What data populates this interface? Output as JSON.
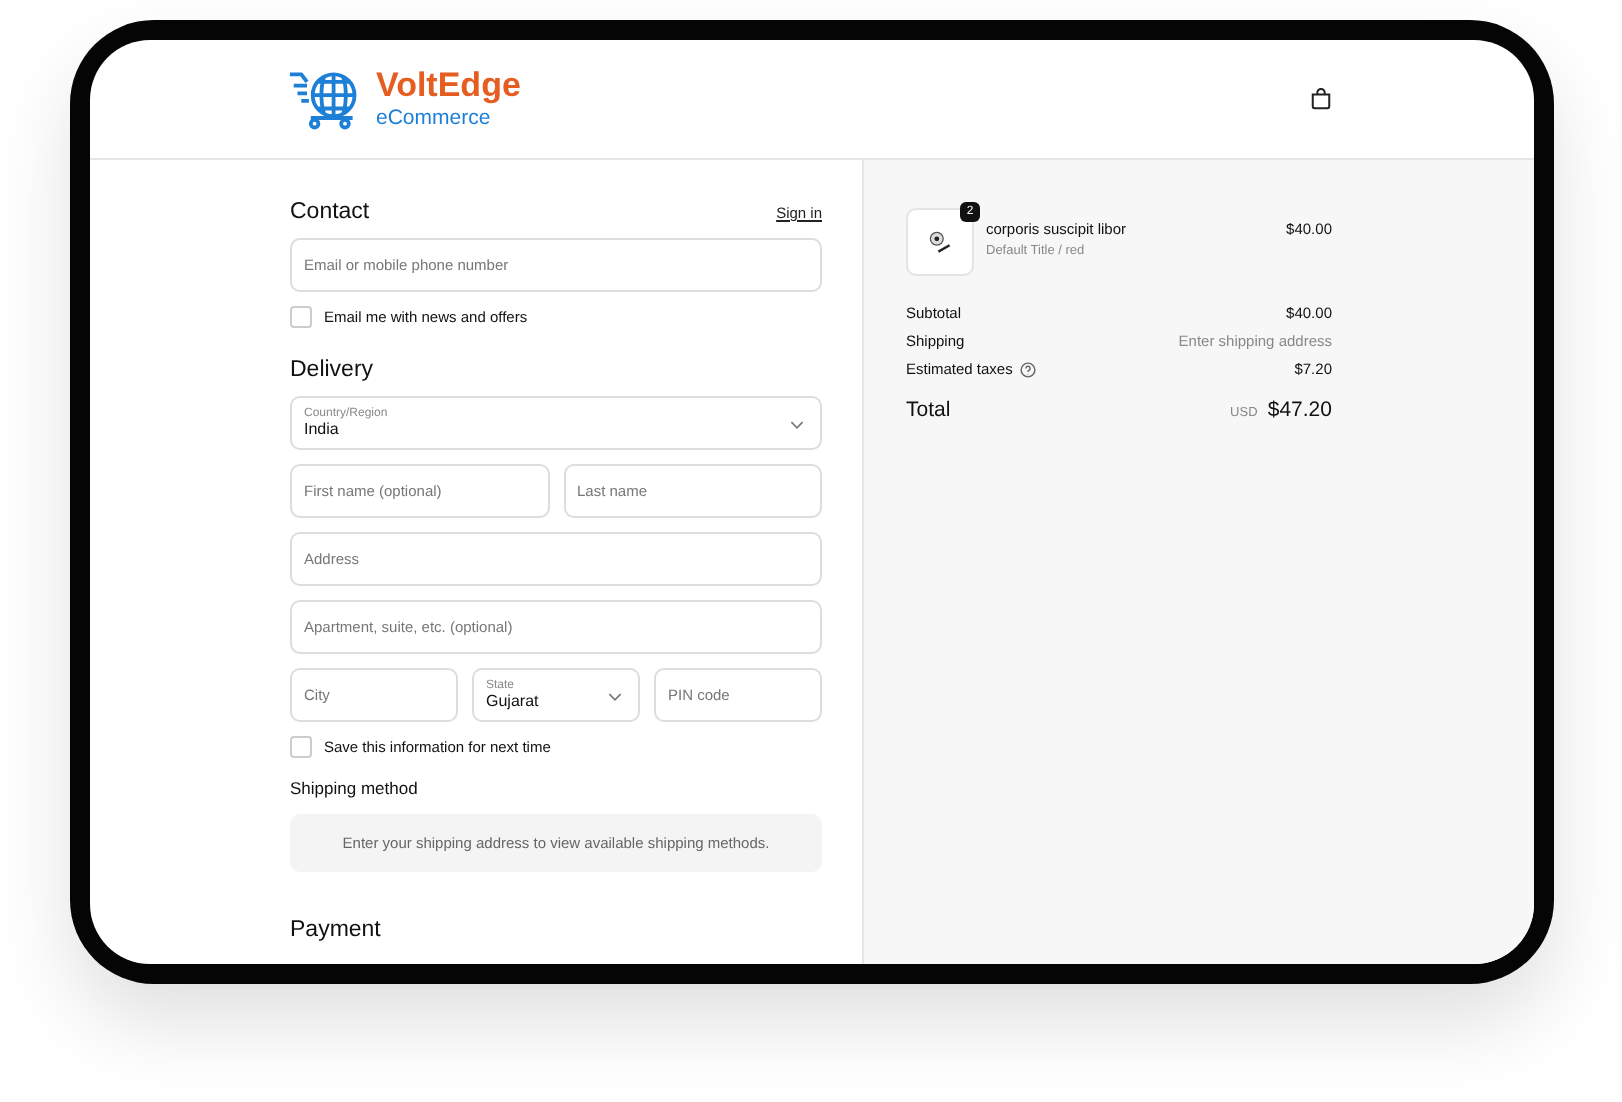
{
  "header": {
    "brand": "VoltEdge",
    "tagline": "eCommerce"
  },
  "contact": {
    "title": "Contact",
    "sign_in": "Sign in",
    "email": {
      "placeholder": "Email or mobile phone number"
    },
    "newsletter": {
      "label": "Email me with news and offers",
      "checked": false
    }
  },
  "delivery": {
    "title": "Delivery",
    "rows": [
      [
        {
          "kind": "select",
          "label": "Country/Region",
          "value": "India"
        }
      ],
      [
        {
          "kind": "text",
          "placeholder": "First name (optional)"
        },
        {
          "kind": "text",
          "placeholder": "Last name"
        }
      ],
      [
        {
          "kind": "text",
          "placeholder": "Address"
        }
      ],
      [
        {
          "kind": "text",
          "placeholder": "Apartment, suite, etc. (optional)"
        }
      ],
      [
        {
          "kind": "text",
          "placeholder": "City"
        },
        {
          "kind": "select",
          "label": "State",
          "value": "Gujarat"
        },
        {
          "kind": "text",
          "placeholder": "PIN code"
        }
      ]
    ],
    "save_info": {
      "label": "Save this information for next time",
      "checked": false
    }
  },
  "shipping_method": {
    "title": "Shipping method",
    "notice": "Enter your shipping address to view available shipping methods."
  },
  "payment": {
    "title": "Payment"
  },
  "order": {
    "items": [
      {
        "quantity": "2",
        "name": "corporis suscipit libor",
        "variant": "Default Title / red",
        "price": "$40.00"
      }
    ],
    "lines": [
      {
        "label": "Subtotal",
        "value": "$40.00",
        "muted": false,
        "info": false
      },
      {
        "label": "Shipping",
        "value": "Enter shipping address",
        "muted": true,
        "info": false
      },
      {
        "label": "Estimated taxes",
        "value": "$7.20",
        "muted": false,
        "info": true
      }
    ],
    "total": {
      "label": "Total",
      "currency": "USD",
      "amount": "$47.20"
    }
  }
}
